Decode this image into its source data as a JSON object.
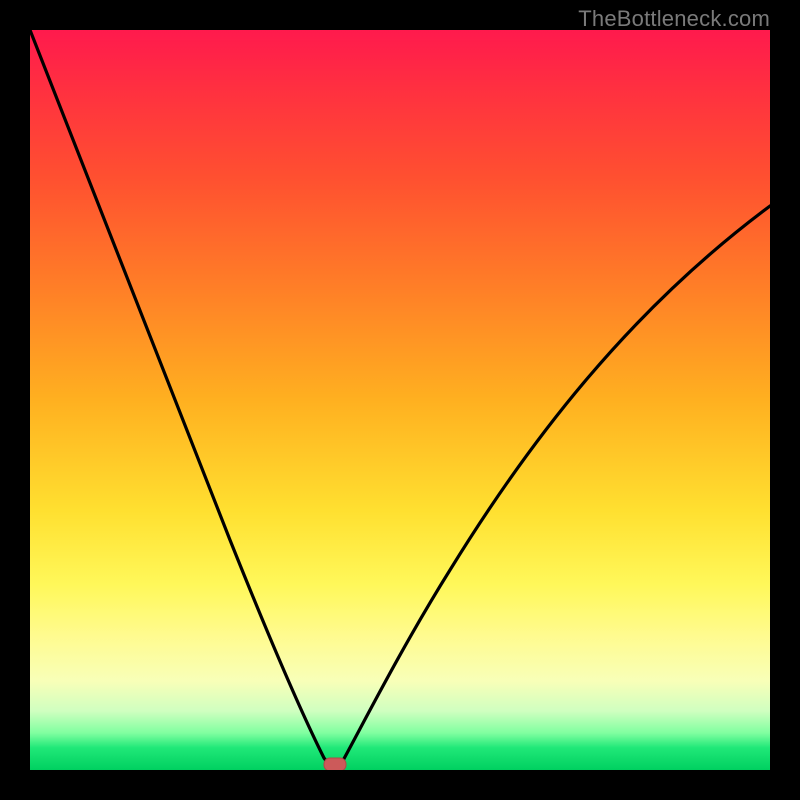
{
  "watermark": "TheBottleneck.com",
  "chart_data": {
    "type": "line",
    "title": "",
    "xlabel": "",
    "ylabel": "",
    "xlim": [
      0,
      100
    ],
    "ylim": [
      0,
      100
    ],
    "grid": false,
    "legend": false,
    "series": [
      {
        "name": "bottleneck-curve",
        "x": [
          0,
          3,
          6,
          9,
          12,
          15,
          18,
          21,
          24,
          27,
          30,
          32,
          34,
          36,
          37,
          38,
          39,
          40,
          41,
          42,
          45,
          50,
          55,
          60,
          65,
          70,
          75,
          80,
          85,
          90,
          95,
          100
        ],
        "values": [
          100,
          92,
          84,
          76,
          69,
          61,
          54,
          47,
          40,
          33,
          26,
          21,
          16,
          11,
          8,
          5,
          2,
          0,
          0,
          2,
          8,
          16,
          24,
          31,
          38,
          44,
          50,
          56,
          61,
          66,
          71,
          76
        ]
      }
    ],
    "marker": {
      "name": "optimal-point",
      "x": 40.5,
      "y": 0,
      "color": "#cc5a5a",
      "shape": "rounded-rect"
    },
    "background_gradient": {
      "top": "#ff1a4d",
      "mid": "#ffe030",
      "bottom": "#00d060"
    }
  }
}
